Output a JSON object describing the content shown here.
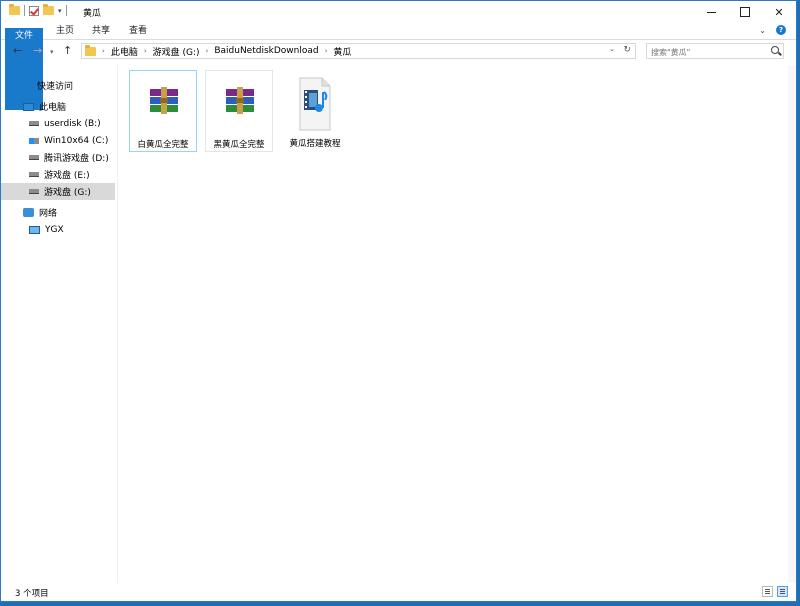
{
  "window": {
    "title": "黄瓜"
  },
  "ribbon": {
    "tabs": [
      {
        "label": "文件"
      },
      {
        "label": "主页"
      },
      {
        "label": "共享"
      },
      {
        "label": "查看"
      }
    ]
  },
  "address": {
    "breadcrumbs": [
      "此电脑",
      "游戏盘 (G:)",
      "BaiduNetdiskDownload",
      "黄瓜"
    ]
  },
  "search": {
    "placeholder": "搜索\"黄瓜\""
  },
  "navpane": {
    "items": [
      {
        "label": "快速访问",
        "icon": "star-icon"
      },
      {
        "label": "此电脑",
        "icon": "computer-icon"
      },
      {
        "label": "userdisk (B:)",
        "icon": "drive-icon"
      },
      {
        "label": "Win10x64 (C:)",
        "icon": "system-drive-icon"
      },
      {
        "label": "腾讯游戏盘 (D:)",
        "icon": "drive-icon"
      },
      {
        "label": "游戏盘 (E:)",
        "icon": "drive-icon"
      },
      {
        "label": "游戏盘 (G:)",
        "icon": "drive-icon",
        "selected": true
      },
      {
        "label": "网络",
        "icon": "network-icon"
      },
      {
        "label": "YGX",
        "icon": "computer-icon"
      }
    ]
  },
  "files": [
    {
      "name": "白黄瓜全完整",
      "icon": "winrar-archive-icon"
    },
    {
      "name": "黑黄瓜全完整",
      "icon": "winrar-archive-icon"
    },
    {
      "name": "黄瓜搭建教程",
      "icon": "media-file-icon"
    }
  ],
  "status": {
    "count_text": "3 个项目"
  }
}
